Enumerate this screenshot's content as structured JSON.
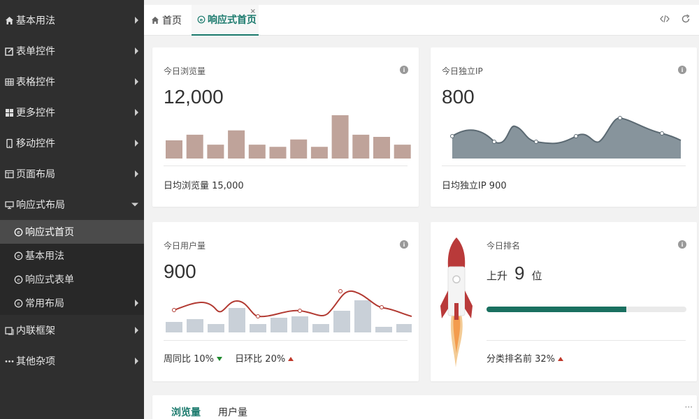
{
  "sidebar": {
    "items": [
      {
        "label": "基本用法",
        "icon": "home-icon"
      },
      {
        "label": "表单控件",
        "icon": "edit-icon"
      },
      {
        "label": "表格控件",
        "icon": "table-icon"
      },
      {
        "label": "更多控件",
        "icon": "grid-icon"
      },
      {
        "label": "移动控件",
        "icon": "mobile-icon"
      },
      {
        "label": "页面布局",
        "icon": "layout-icon"
      },
      {
        "label": "响应式布局",
        "icon": "monitor-icon"
      }
    ],
    "sub_items": [
      {
        "label": "响应式首页",
        "icon": "circle-icon"
      },
      {
        "label": "基本用法",
        "icon": "circle-icon"
      },
      {
        "label": "响应式表单",
        "icon": "circle-icon"
      },
      {
        "label": "常用布局",
        "icon": "circle-icon"
      }
    ],
    "after_items": [
      {
        "label": "内联框架",
        "icon": "frame-icon"
      },
      {
        "label": "其他杂项",
        "icon": "ellipsis-icon"
      }
    ]
  },
  "tabs": {
    "home_label": "首页",
    "active_label": "响应式首页",
    "close_glyph": "×"
  },
  "cards": {
    "views": {
      "title": "今日浏览量",
      "value": "12,000",
      "footer": "日均浏览量 15,000",
      "bars": [
        0.42,
        0.55,
        0.32,
        0.65,
        0.32,
        0.27,
        0.44,
        0.27,
        1.0,
        0.55,
        0.5,
        0.32
      ],
      "bar_color": "#bfa39a"
    },
    "ip": {
      "title": "今日独立IP",
      "value": "800",
      "footer": "日均独立IP 900",
      "area_color": "#87949c"
    },
    "users": {
      "title": "今日用户量",
      "value": "900",
      "yoy_label": "周同比 10%",
      "mom_label": "日环比 20%",
      "line_color": "#b23a32",
      "bar_color": "#c9d0d8"
    },
    "rank": {
      "title": "今日排名",
      "prefix": "上升",
      "value": "9",
      "suffix": "位",
      "progress": 0.7,
      "progress_color": "#1a7060",
      "footer": "分类排名前 32%"
    }
  },
  "bottom": {
    "tab_views": "浏览量",
    "tab_users": "用户量",
    "more": "···"
  },
  "colors": {
    "accent": "#1b7a6d",
    "sidebar_bg": "#2f2f2f",
    "down": "#1e8a2e",
    "up": "#c0392b"
  }
}
